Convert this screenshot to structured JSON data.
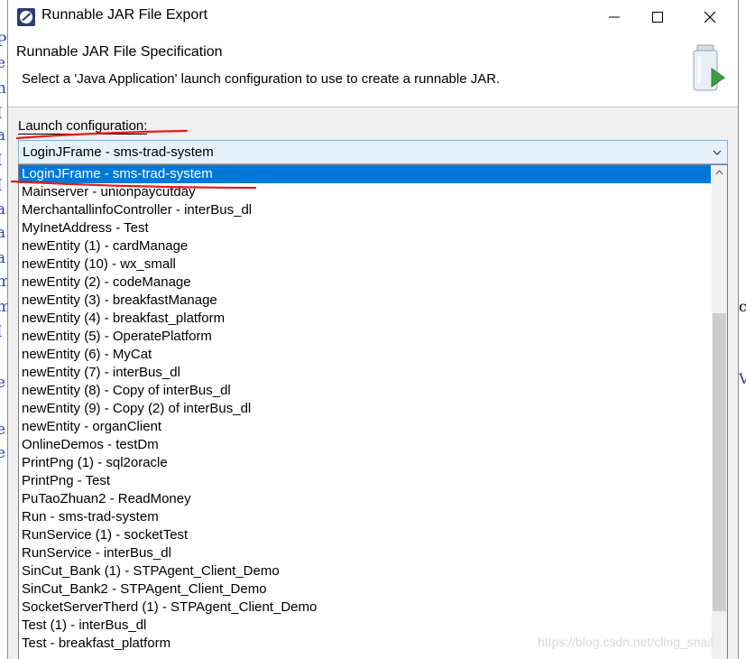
{
  "window": {
    "title": "Runnable JAR File Export"
  },
  "header": {
    "title": "Runnable JAR File Specification",
    "description": "Select a 'Java Application' launch configuration to use to create a runnable JAR."
  },
  "launch": {
    "label": "Launch configuration:",
    "selected_value": "LoginJFrame - sms-trad-system",
    "items": [
      "LoginJFrame - sms-trad-system",
      "Mainserver - unionpaycutday",
      "MerchantallinfoController - interBus_dl",
      "MyInetAddress - Test",
      "newEntity (1) - cardManage",
      "newEntity (10) - wx_small",
      "newEntity (2) - codeManage",
      "newEntity (3) - breakfastManage",
      "newEntity (4) - breakfast_platform",
      "newEntity (5) - OperatePlatform",
      "newEntity (6) - MyCat",
      "newEntity (7) - interBus_dl",
      "newEntity (8) - Copy of interBus_dl",
      "newEntity (9) - Copy (2) of interBus_dl",
      "newEntity - organClient",
      "OnlineDemos - testDm",
      "PrintPng (1) - sql2oracle",
      "PrintPng - Test",
      "PuTaoZhuan2 - ReadMoney",
      "Run - sms-trad-system",
      "RunService (1) - socketTest",
      "RunService - interBus_dl",
      "SinCut_Bank (1) - STPAgent_Client_Demo",
      "SinCut_Bank2 - STPAgent_Client_Demo",
      "SocketServerTherd (1) - STPAgent_Client_Demo",
      "Test (1) - interBus_dl",
      "Test - breakfast_platform"
    ],
    "selected_index": 0
  },
  "watermark": "https://blog.csdn.net/cling_snail",
  "colors": {
    "selection": "#0078d7",
    "combo_bg": "#e5f1fb",
    "annotation_red": "#e8191c"
  },
  "icons": {
    "app": "eclipse-icon",
    "banner": "jar-export-icon"
  }
}
